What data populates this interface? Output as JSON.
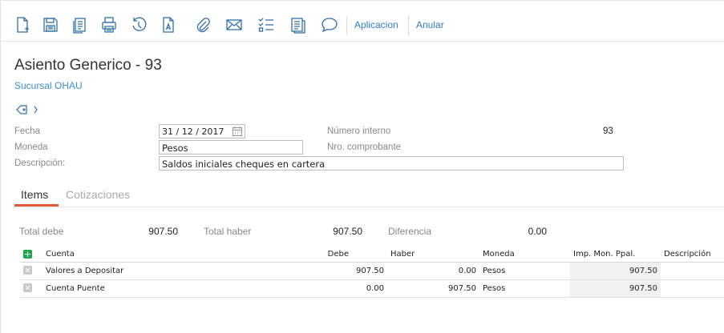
{
  "toolbar": {
    "icons": [
      "new-document-icon",
      "save-icon",
      "copy-icon",
      "print-icon",
      "history-icon",
      "document-a-icon",
      "attach-icon",
      "email-icon",
      "checklist-icon",
      "report-icon",
      "comment-icon"
    ],
    "aplicacion_label": "Aplicacion",
    "anular_label": "Anular",
    "accent": "#2f7dc0"
  },
  "header": {
    "title": "Asiento Generico - 93",
    "branch": "Sucursal OHAU",
    "tag_icon": "tag-icon",
    "chevron_icon": "chevron-right-icon"
  },
  "form": {
    "fecha_label": "Fecha",
    "fecha_value": "31 / 12 / 2017",
    "moneda_label": "Moneda",
    "moneda_value": "Pesos",
    "descripcion_label": "Descripción:",
    "descripcion_value": "Saldos iniciales cheques en cartera",
    "numero_interno_label": "Número interno",
    "numero_interno_value": "93",
    "nro_comprobante_label": "Nro. comprobante",
    "nro_comprobante_value": ""
  },
  "tabs": [
    {
      "label": "Items",
      "active": true
    },
    {
      "label": "Cotizaciones",
      "active": false
    }
  ],
  "totals": {
    "debe_label": "Total debe",
    "debe_value": "907.50",
    "haber_label": "Total haber",
    "haber_value": "907.50",
    "diferencia_label": "Diferencia",
    "diferencia_value": "0.00"
  },
  "grid": {
    "columns": [
      "Cuenta",
      "Debe",
      "Haber",
      "Moneda",
      "Imp. Mon. Ppal.",
      "Descripción"
    ],
    "rows": [
      {
        "cuenta": "Valores a Depositar",
        "debe": "907.50",
        "haber": "0.00",
        "moneda": "Pesos",
        "imp": "907.50",
        "descripcion": ""
      },
      {
        "cuenta": "Cuenta Puente",
        "debe": "0.00",
        "haber": "907.50",
        "moneda": "Pesos",
        "imp": "907.50",
        "descripcion": ""
      }
    ]
  },
  "colors": {
    "accent": "#2f7dc0",
    "tab_underline": "#e05a3a",
    "add_green": "#19a94a"
  }
}
